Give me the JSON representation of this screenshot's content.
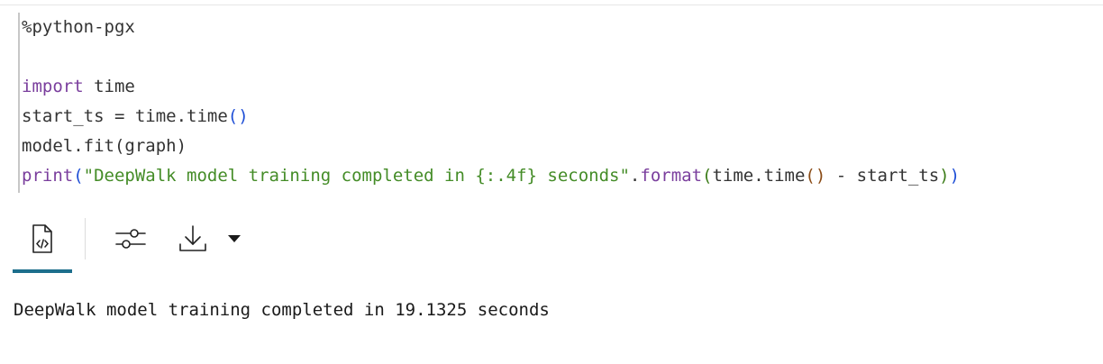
{
  "cell": {
    "magic": "%python-pgx",
    "code": {
      "l3_kw": "import",
      "l3_rest": " time",
      "l4_a": "start_ts = time.time",
      "l4_p_open": "(",
      "l4_p_close": ")",
      "l5": "model.fit(graph)",
      "l6_print": "print",
      "l6_p_open": "(",
      "l6_str": "\"DeepWalk model training completed in {:.4f} seconds\"",
      "l6_dot": ".",
      "l6_format": "format",
      "l6_p2_open": "(",
      "l6_time": "time.time",
      "l6_p3": "()",
      "l6_minus": " - start_ts",
      "l6_p2_close": ")",
      "l6_p_close": ")"
    }
  },
  "toolbar": {
    "buttons": [
      {
        "name": "code-view-icon",
        "active": true
      },
      {
        "name": "settings-sliders-icon",
        "active": false
      },
      {
        "name": "download-icon",
        "active": false
      },
      {
        "name": "caret-down-icon",
        "active": false
      }
    ]
  },
  "output": {
    "text": "DeepWalk model training completed in 19.1325 seconds"
  },
  "colors": {
    "keyword": "#7a3e9d",
    "string": "#448c27",
    "active_tab": "#1c6e8c"
  }
}
